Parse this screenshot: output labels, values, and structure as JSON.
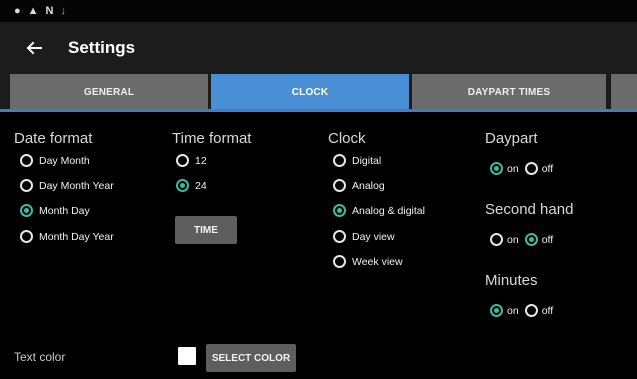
{
  "status_bar": {
    "icons": [
      {
        "name": "shield-icon",
        "glyph": "●"
      },
      {
        "name": "warning-icon",
        "glyph": "▲"
      },
      {
        "name": "notification-n-icon",
        "glyph": "N"
      },
      {
        "name": "download-icon",
        "glyph": "↓"
      }
    ]
  },
  "app_bar": {
    "title": "Settings"
  },
  "tabs": [
    {
      "label": "GENERAL",
      "active": false
    },
    {
      "label": "CLOCK",
      "active": true
    },
    {
      "label": "DAYPART TIMES",
      "active": false
    }
  ],
  "date_format": {
    "title": "Date format",
    "options": [
      {
        "label": "Day Month",
        "selected": false
      },
      {
        "label": "Day Month Year",
        "selected": false
      },
      {
        "label": "Month Day",
        "selected": true
      },
      {
        "label": "Month Day Year",
        "selected": false
      }
    ]
  },
  "time_format": {
    "title": "Time format",
    "options": [
      {
        "label": "12",
        "selected": false
      },
      {
        "label": "24",
        "selected": true
      }
    ],
    "button_label": "TIME"
  },
  "clock": {
    "title": "Clock",
    "options": [
      {
        "label": "Digital",
        "selected": false
      },
      {
        "label": "Analog",
        "selected": false
      },
      {
        "label": "Analog & digital",
        "selected": true
      },
      {
        "label": "Day view",
        "selected": false
      },
      {
        "label": "Week view",
        "selected": false
      }
    ]
  },
  "daypart": {
    "title": "Daypart",
    "on_label": "on",
    "off_label": "off",
    "value": "on"
  },
  "second_hand": {
    "title": "Second hand",
    "on_label": "on",
    "off_label": "off",
    "value": "off"
  },
  "minutes": {
    "title": "Minutes",
    "on_label": "on",
    "off_label": "off",
    "value": "on"
  },
  "text_color": {
    "label": "Text color",
    "swatch_color": "#ffffff",
    "button_label": "SELECT COLOR"
  },
  "colors": {
    "accent_tab": "#4a8fd6",
    "radio_selected": "#3fb9a3"
  }
}
